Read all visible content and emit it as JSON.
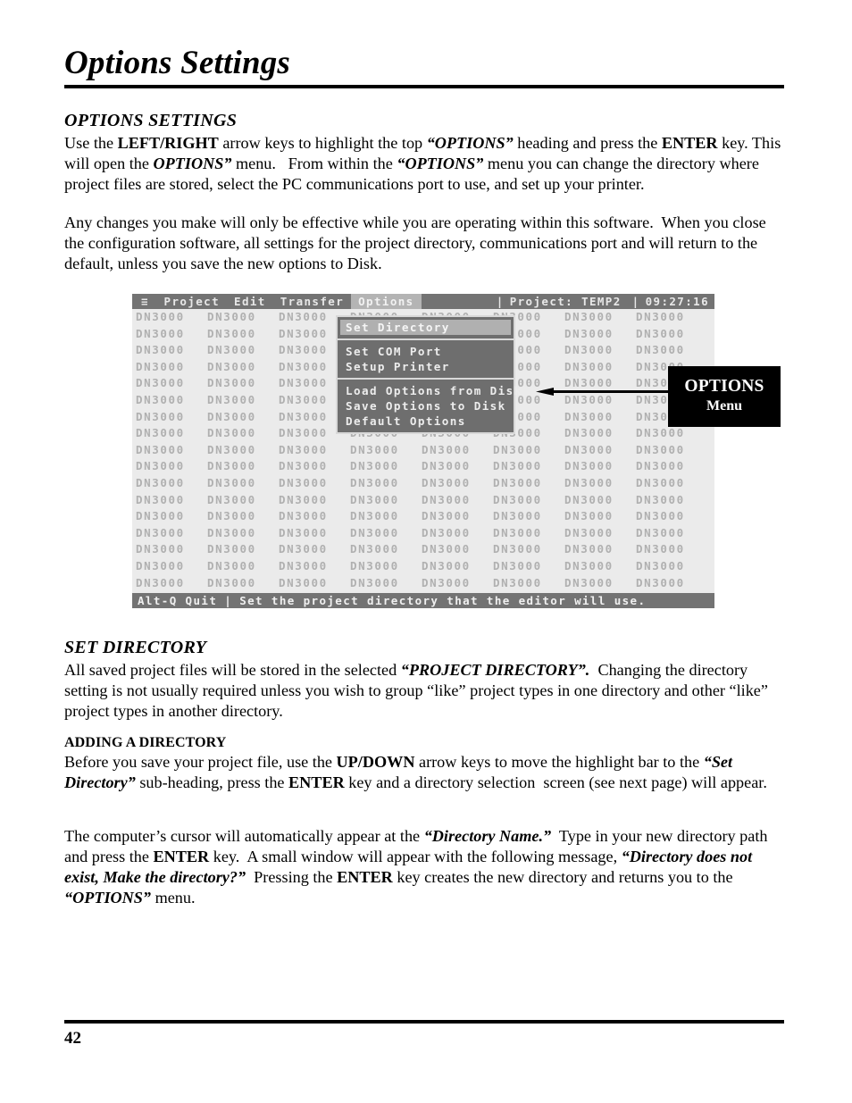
{
  "document": {
    "page_title": "Options Settings",
    "page_number": "42"
  },
  "sections": [
    {
      "heading": "OPTIONS SETTINGS",
      "paragraphs": [
        "Use the LEFT/RIGHT arrow keys to highlight the top “OPTIONS” heading and press the ENTER key. This will open the OPTIONS” menu.   From within the “OPTIONS” menu you can change the directory where project files are stored, select the PC communications port to use, and set up your printer.",
        "Any changes you make will only be effective while you are operating within this software.  When you close the configuration software, all settings for the project directory, communications port and will return to the default, unless you save the new options to Disk."
      ]
    },
    {
      "heading": "SET DIRECTORY",
      "paragraphs": [
        "All saved project files will be stored in the selected “PROJECT DIRECTORY”.  Changing the directory setting is not usually required unless you wish to group “like” project types in one directory and other “like” project types in another directory."
      ]
    },
    {
      "heading": "ADDING A DIRECTORY",
      "paragraphs": [
        "Before you save your project file, use the UP/DOWN arrow keys to move the highlight bar to the “Set Directory” sub-heading, press the ENTER key and a directory selection  screen (see next page) will appear.",
        "The computer’s cursor will automatically appear at the “Directory Name.”  Type in your new directory path and press the ENTER key.  A small window will appear with the following message, “Directory does not exist, Make the directory?”  Pressing the ENTER key creates the new directory and returns you to the “OPTIONS” menu."
      ]
    }
  ],
  "screenshot": {
    "menubar": {
      "hamburger": "≡",
      "items": [
        {
          "label": "Project",
          "active": false
        },
        {
          "label": "Edit",
          "active": false
        },
        {
          "label": "Transfer",
          "active": false
        },
        {
          "label": "Options",
          "active": true
        }
      ],
      "separator": "|",
      "project_label": "Project: TEMP2",
      "clock": "09:27:16"
    },
    "dropdown": {
      "groups": [
        [
          {
            "label": "Set Directory",
            "selected": true
          }
        ],
        [
          {
            "label": "Set COM Port",
            "selected": false
          },
          {
            "label": "Setup Printer",
            "selected": false
          }
        ],
        [
          {
            "label": "Load Options from Disk",
            "selected": false
          },
          {
            "label": "Save Options to Disk",
            "selected": false
          },
          {
            "label": "Default Options",
            "selected": false
          }
        ]
      ]
    },
    "statusbar": {
      "quit_hint": "Alt-Q Quit",
      "separator": "|",
      "help_text": "Set the project directory that the editor will use."
    },
    "wallpaper": {
      "tile_text": "DN3000",
      "columns": 8,
      "rows": 17
    },
    "callout": {
      "title": "OPTIONS",
      "subtitle": "Menu"
    },
    "colors": {
      "menubar_bg": "#737373",
      "wallpaper_bg": "#ebebeb",
      "wallpaper_text": "#b0b0b0",
      "dropdown_bg": "#6e6e6e",
      "dropdown_border": "#d8d8d8",
      "highlight_bg": "#b0b0b0",
      "callout_bg": "#000000",
      "callout_text": "#ffffff"
    }
  }
}
